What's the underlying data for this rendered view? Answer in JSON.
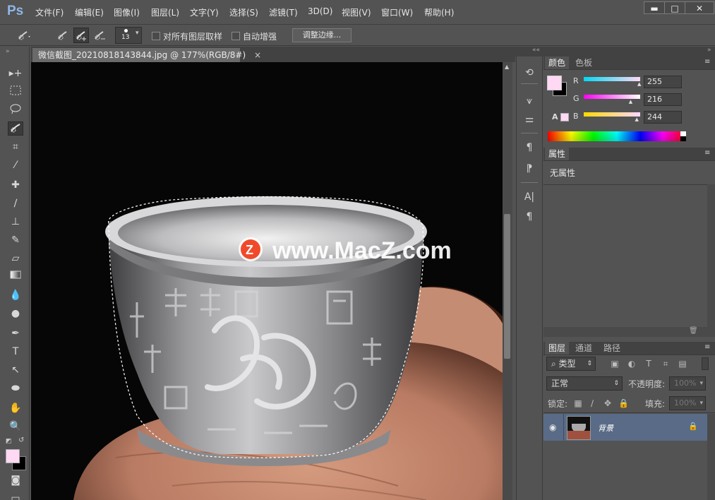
{
  "app": {
    "logo": "Ps"
  },
  "menu": [
    "文件(F)",
    "编辑(E)",
    "图像(I)",
    "图层(L)",
    "文字(Y)",
    "选择(S)",
    "滤镜(T)",
    "3D(D)",
    "视图(V)",
    "窗口(W)",
    "帮助(H)"
  ],
  "window_controls": {
    "minimize": "▬",
    "restore": "□",
    "close": "✕"
  },
  "options": {
    "brush_size": "13",
    "sample_all_layers": "对所有图层取样",
    "auto_enhance": "自动增强",
    "refine_edge": "调整边缘..."
  },
  "document": {
    "tab_title": "微信截图_20210818143844.jpg @ 177%(RGB/8#)",
    "close": "×",
    "watermark": "www.MacZ.com"
  },
  "color_panel": {
    "tabs": [
      "颜色",
      "色板"
    ],
    "channels": [
      {
        "label": "R",
        "value": "255",
        "fraction": 1.0,
        "gradient": "linear-gradient(90deg,#00d8f4,#ffd8f4)"
      },
      {
        "label": "G",
        "value": "216",
        "fraction": 0.847,
        "gradient": "linear-gradient(90deg,#ff00f4,#ffffff)"
      },
      {
        "label": "B",
        "value": "244",
        "fraction": 0.957,
        "gradient": "linear-gradient(90deg,#ffd800,#ffd8ff)"
      }
    ],
    "foreground": "#ffd8f4",
    "background": "#000000"
  },
  "properties_panel": {
    "tab": "属性",
    "content": "无属性"
  },
  "layers_panel": {
    "tabs": [
      "图层",
      "通道",
      "路径"
    ],
    "filter": "类型",
    "blend_mode": "正常",
    "opacity_label": "不透明度:",
    "opacity_value": "100%",
    "lock_label": "锁定:",
    "fill_label": "填充:",
    "fill_value": "100%",
    "layers": [
      {
        "name": "背景",
        "locked": true
      }
    ]
  }
}
